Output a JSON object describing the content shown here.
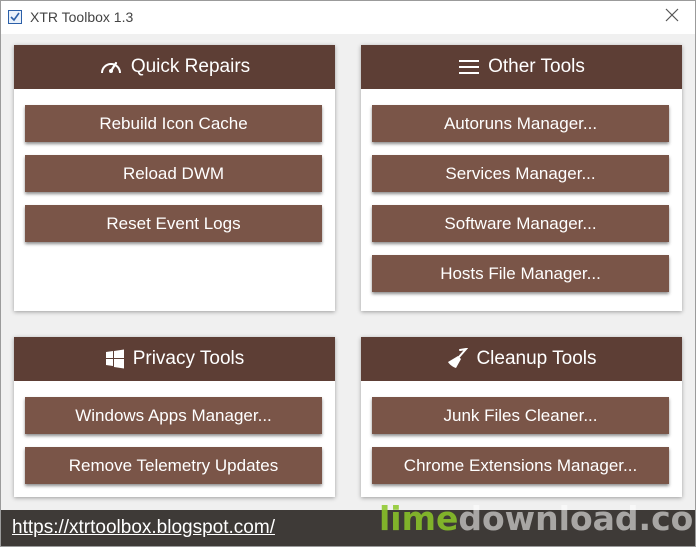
{
  "window": {
    "title": "XTR Toolbox 1.3"
  },
  "panels": {
    "quick_repairs": {
      "title": "Quick Repairs",
      "icon": "speedometer-icon",
      "buttons": [
        "Rebuild Icon Cache",
        "Reload DWM",
        "Reset Event Logs"
      ]
    },
    "other_tools": {
      "title": "Other Tools",
      "icon": "menu-icon",
      "buttons": [
        "Autoruns Manager...",
        "Services Manager...",
        "Software Manager...",
        "Hosts File Manager..."
      ]
    },
    "privacy_tools": {
      "title": "Privacy Tools",
      "icon": "windows-icon",
      "buttons": [
        "Windows Apps Manager...",
        "Remove Telemetry Updates"
      ]
    },
    "cleanup_tools": {
      "title": "Cleanup Tools",
      "icon": "broom-icon",
      "buttons": [
        "Junk Files Cleaner...",
        "Chrome Extensions Manager..."
      ]
    }
  },
  "footer": {
    "link": "https://xtrtoolbox.blogspot.com/"
  },
  "watermark": {
    "part1": "lime",
    "part2": "download.com"
  },
  "colors": {
    "header": "#5d3e35",
    "button": "#7a5548",
    "footer": "#3e3a37",
    "background": "#f0f0f0"
  }
}
